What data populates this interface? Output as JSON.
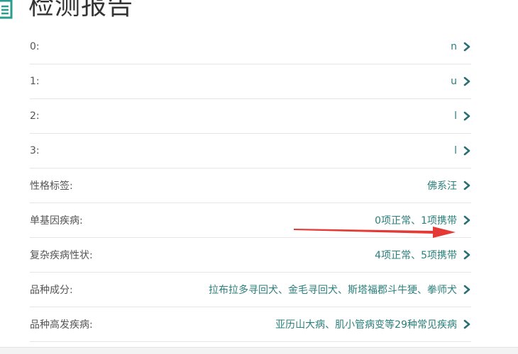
{
  "header": {
    "title": "检测报告",
    "icon": "document-icon",
    "accent": "#2a9d8f"
  },
  "rows": [
    {
      "label": "0:",
      "value": "n"
    },
    {
      "label": "1:",
      "value": "u"
    },
    {
      "label": "2:",
      "value": "l"
    },
    {
      "label": "3:",
      "value": "l"
    },
    {
      "label": "性格标签:",
      "value": "佛系汪"
    },
    {
      "label": "单基因疾病:",
      "value": "0项正常、1项携带"
    },
    {
      "label": "复杂疾病性状:",
      "value": "4项正常、5项携带"
    },
    {
      "label": "品种成分:",
      "value": "拉布拉多寻回犬、金毛寻回犬、斯塔福郡斗牛㹴、拳师犬"
    },
    {
      "label": "品种高发疾病:",
      "value": "亚历山大病、肌小管病变等29种常见疾病"
    }
  ],
  "colors": {
    "value_text": "#2a7f7b",
    "label_text": "#555555",
    "chevron": "#2a6f73",
    "annotation_arrow": "#e53935"
  }
}
